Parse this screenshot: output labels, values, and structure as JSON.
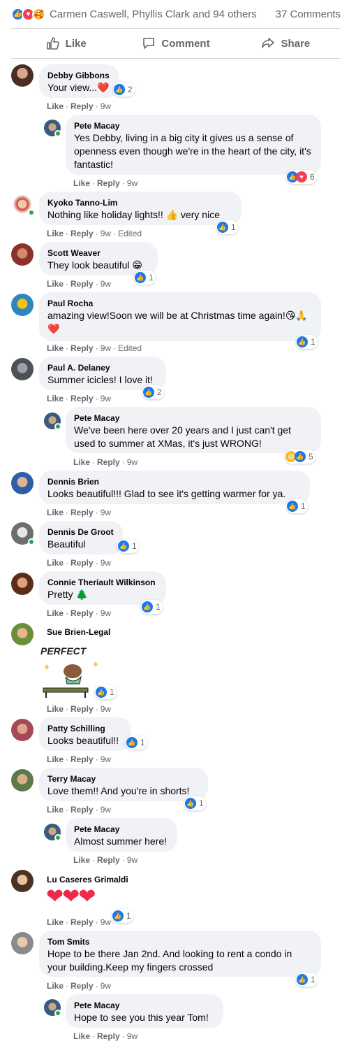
{
  "summary": {
    "reactors": "Carmen Caswell, Phyllis Clark and 94 others",
    "comments_count": "37 Comments"
  },
  "actions": {
    "like": "Like",
    "comment": "Comment",
    "share": "Share"
  },
  "meta": {
    "like": "Like",
    "reply": "Reply",
    "dot": "·",
    "edited": "Edited"
  },
  "colors": {
    "accent": "#1877f2",
    "love": "#f33e58",
    "bubble": "#f0f2f5",
    "muted": "#65676b"
  },
  "comments": [
    {
      "name": "Debby Gibbons",
      "text": "Your view...❤️",
      "time": "9w",
      "reactions": "2"
    },
    {
      "name": "Pete Macay",
      "text": "Yes Debby, living in a big city it gives us a sense of openness even though we're in the heart of the city, it's fantastic!",
      "time": "9w",
      "reactions": "6"
    },
    {
      "name": "Kyoko Tanno-Lim",
      "text": "Nothing like holiday lights!! 👍 very nice",
      "time": "9w",
      "reactions": "1"
    },
    {
      "name": "Scott Weaver",
      "text": "They look beautiful 😁",
      "time": "9w",
      "reactions": "1"
    },
    {
      "name": "Paul Rocha",
      "text": "amazing view!Soon we will be at Christmas time again!😘🙏❤️",
      "time": "9w",
      "reactions": "1"
    },
    {
      "name": "Paul A. Delaney",
      "text": "Summer icicles! I love it!",
      "time": "9w",
      "reactions": "2"
    },
    {
      "name": "Pete Macay",
      "text": "We've been here over 20 years and I just can't get used to summer at XMas, it's just WRONG!",
      "time": "9w",
      "reactions": "5"
    },
    {
      "name": "Dennis Brien",
      "text": "Looks beautiful!!! Glad to see it's getting warmer for ya.",
      "time": "9w",
      "reactions": "1"
    },
    {
      "name": "Dennis De Groot",
      "text": "Beautiful",
      "time": "9w",
      "reactions": "1"
    },
    {
      "name": "Connie Theriault Wilkinson",
      "text": "Pretty 🌲",
      "time": "9w",
      "reactions": "1"
    },
    {
      "name": "Sue Brien-Legal",
      "sticker_text": "PERFECT",
      "time": "9w",
      "reactions": "1"
    },
    {
      "name": "Patty Schilling",
      "text": "Looks beautiful!!",
      "time": "9w",
      "reactions": "1"
    },
    {
      "name": "Terry Macay",
      "text": "Love them!! And you're in shorts!",
      "time": "9w",
      "reactions": "1"
    },
    {
      "name": "Pete Macay",
      "text": "Almost summer here!",
      "time": "9w"
    },
    {
      "name": "Lu Caseres Grimaldi",
      "text": "❤❤❤",
      "time": "9w",
      "reactions": "1"
    },
    {
      "name": "Tom Smits",
      "text": "Hope to be there Jan 2nd. And looking to rent a condo in your building.Keep my fingers crossed",
      "time": "9w",
      "reactions": "1"
    },
    {
      "name": "Pete Macay",
      "text": "Hope to see you this year Tom!",
      "time": "9w"
    }
  ]
}
